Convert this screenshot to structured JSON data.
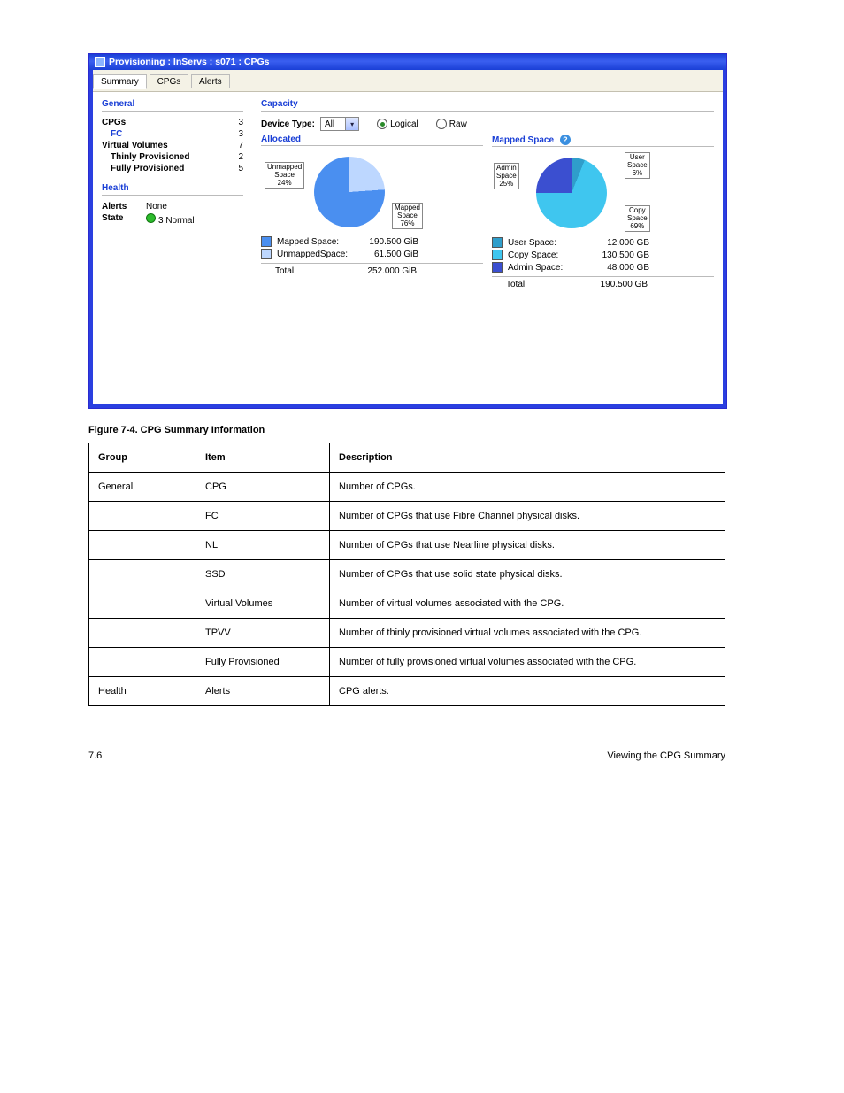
{
  "titlebar": "Provisioning : InServs : s071 : CPGs",
  "tabs": {
    "summary": "Summary",
    "cpgs": "CPGs",
    "alerts": "Alerts"
  },
  "general": {
    "title": "General",
    "rows": {
      "cpgs_lbl": "CPGs",
      "cpgs_val": "3",
      "fc_lbl": "FC",
      "fc_val": "3",
      "vv_lbl": "Virtual Volumes",
      "vv_val": "7",
      "thin_lbl": "Thinly Provisioned",
      "thin_val": "2",
      "full_lbl": "Fully Provisioned",
      "full_val": "5"
    }
  },
  "health": {
    "title": "Health",
    "alerts_lbl": "Alerts",
    "alerts_val": "None",
    "state_lbl": "State",
    "state_val": "3 Normal"
  },
  "capacity": {
    "title": "Capacity",
    "device_lbl": "Device Type:",
    "device_val": "All",
    "logical": "Logical",
    "raw": "Raw"
  },
  "allocated": {
    "title": "Allocated",
    "callouts": {
      "unmapped": "Unmapped\nSpace\n24%",
      "mapped": "Mapped\nSpace\n76%"
    },
    "legend": {
      "mapped_lbl": "Mapped Space:",
      "mapped_val": "190.500 GiB",
      "unmapped_lbl": "UnmappedSpace:",
      "unmapped_val": "61.500 GiB",
      "total_lbl": "Total:",
      "total_val": "252.000 GiB"
    }
  },
  "mapped": {
    "title": "Mapped Space",
    "callouts": {
      "admin": "Admin\nSpace\n25%",
      "user": "User\nSpace\n6%",
      "copy": "Copy\nSpace\n69%"
    },
    "legend": {
      "user_lbl": "User Space:",
      "user_val": "12.000 GB",
      "copy_lbl": "Copy Space:",
      "copy_val": "130.500 GB",
      "admin_lbl": "Admin Space:",
      "admin_val": "48.000 GB",
      "total_lbl": "Total:",
      "total_val": "190.500 GB"
    }
  },
  "chart_data": [
    {
      "type": "pie",
      "title": "Allocated",
      "series": [
        {
          "name": "Mapped Space",
          "value": 190.5,
          "percent": 76
        },
        {
          "name": "Unmapped Space",
          "value": 61.5,
          "percent": 24
        }
      ],
      "total": 252.0,
      "unit": "GiB"
    },
    {
      "type": "pie",
      "title": "Mapped Space",
      "series": [
        {
          "name": "User Space",
          "value": 12.0,
          "percent": 6
        },
        {
          "name": "Copy Space",
          "value": 130.5,
          "percent": 69
        },
        {
          "name": "Admin Space",
          "value": 48.0,
          "percent": 25
        }
      ],
      "total": 190.5,
      "unit": "GB"
    }
  ],
  "figure_caption": "Figure 7-4.  CPG Summary Information",
  "table": {
    "h1": "Group",
    "h2": "Item",
    "h3": "Description",
    "rows": [
      {
        "g": "General",
        "i": "CPG",
        "d": "Number of CPGs."
      },
      {
        "g": "",
        "i": "FC",
        "d": "Number of CPGs that use Fibre Channel physical disks."
      },
      {
        "g": "",
        "i": "NL",
        "d": "Number of CPGs that use Nearline physical disks."
      },
      {
        "g": "",
        "i": "SSD",
        "d": "Number of CPGs that use solid state physical disks."
      },
      {
        "g": "",
        "i": "Virtual Volumes",
        "d": "Number of virtual volumes associated with the CPG."
      },
      {
        "g": "",
        "i": "TPVV",
        "d": "Number of thinly provisioned virtual volumes associated with the CPG."
      },
      {
        "g": "",
        "i": "Fully Provisioned",
        "d": "Number of fully provisioned virtual volumes associated with the CPG."
      },
      {
        "g": "Health",
        "i": "Alerts",
        "d": "CPG alerts."
      }
    ]
  },
  "footer": {
    "left": "7.6",
    "right": "Viewing the CPG Summary"
  }
}
